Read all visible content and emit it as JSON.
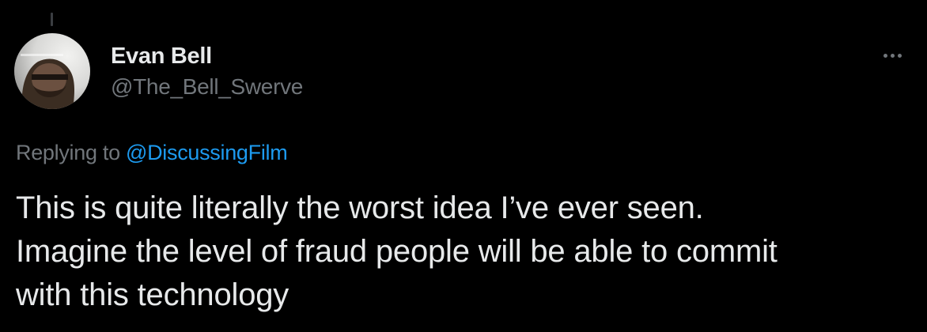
{
  "author": {
    "display_name": "Evan Bell",
    "handle": "@The_Bell_Swerve"
  },
  "reply_context": {
    "prefix": "Replying to",
    "mention": "@DiscussingFilm"
  },
  "tweet": {
    "lines": [
      "This is quite literally the worst idea I’ve ever seen.",
      "Imagine the level of fraud people will be able to commit",
      "with this technology"
    ]
  },
  "colors": {
    "background": "#000000",
    "primary_text": "#e7e9ea",
    "secondary_text": "#71767b",
    "link": "#1d9bf0"
  },
  "icons": {
    "more": "more-options-icon"
  }
}
